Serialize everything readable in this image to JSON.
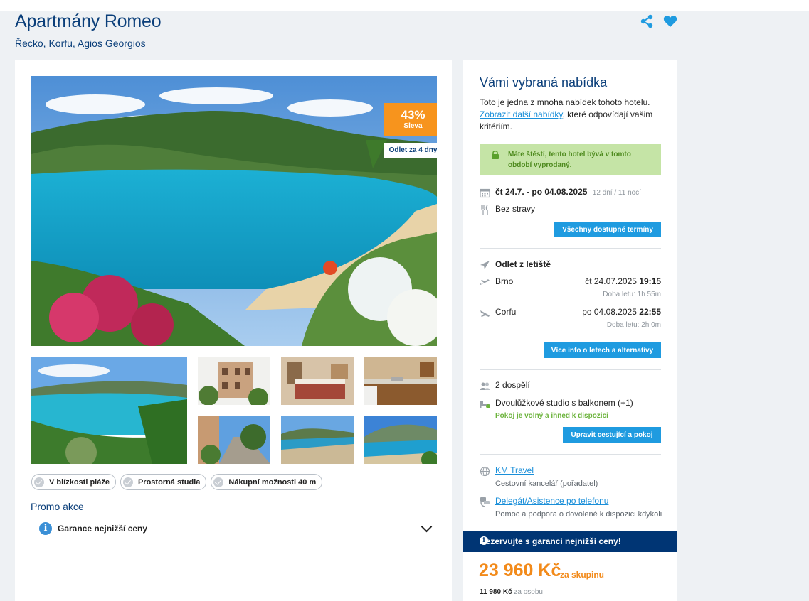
{
  "hotel": {
    "name": "Apartmány Romeo",
    "location": "Řecko, Korfu, Agios Georgios"
  },
  "badge": {
    "discount": "43%",
    "discount_label": "Sleva",
    "departure": "Odlet za 4 dny"
  },
  "features": [
    "V blízkosti pláže",
    "Prostorná studia",
    "Nákupní možnosti 40 m"
  ],
  "promo": {
    "title": "Promo akce",
    "item": "Garance nejnižší ceny"
  },
  "offer": {
    "title": "Vámi vybraná nabídka",
    "text_before": "Toto je jedna z mnoha nabídek tohoto hotelu.",
    "link": "Zobrazit další nabídky",
    "text_after": ", které odpovídají vašim kritériím.",
    "lucky": "Máte štěstí, tento hotel bývá v tomto období vyprodaný.",
    "dates": "čt 24.7. - po 04.08.2025",
    "duration": "12 dní / 11 nocí",
    "board": "Bez stravy",
    "dates_button": "Všechny dostupné termíny"
  },
  "flights": {
    "heading": "Odlet z letiště",
    "outbound": {
      "city": "Brno",
      "date": "čt 24.07.2025",
      "time": "19:15",
      "duration": "Doba letu: 1h 55m"
    },
    "inbound": {
      "city": "Corfu",
      "date": "po 04.08.2025",
      "time": "22:55",
      "duration": "Doba letu: 2h 0m"
    },
    "button": "Více info o letech a alternativy"
  },
  "room": {
    "travelers": "2 dospělí",
    "type": "Dvoulůžkové studio s balkonem (+1)",
    "availability": "Pokoj je volný a ihned k dispozici",
    "button": "Upravit cestující a pokoj"
  },
  "agency": {
    "name": "KM Travel",
    "role": "Cestovní kancelář (pořadatel)",
    "support": "Delegát/Asistence po telefonu",
    "support_desc": "Pomoc a podpora o dovolené k dispozici kdykoli"
  },
  "booking": {
    "guarantee": "Rezervujte s garancí nejnižší ceny!",
    "price": "23 960 Kč",
    "price_suffix": "za skupinu",
    "per_person": "11 980 Kč",
    "per_person_suffix": "za osobu"
  },
  "colors": {
    "brand": "#0b3f7a",
    "accent": "#1f9be0",
    "price": "#f28a1a",
    "badge": "#f7941d",
    "guarantee_bar": "#003574"
  }
}
